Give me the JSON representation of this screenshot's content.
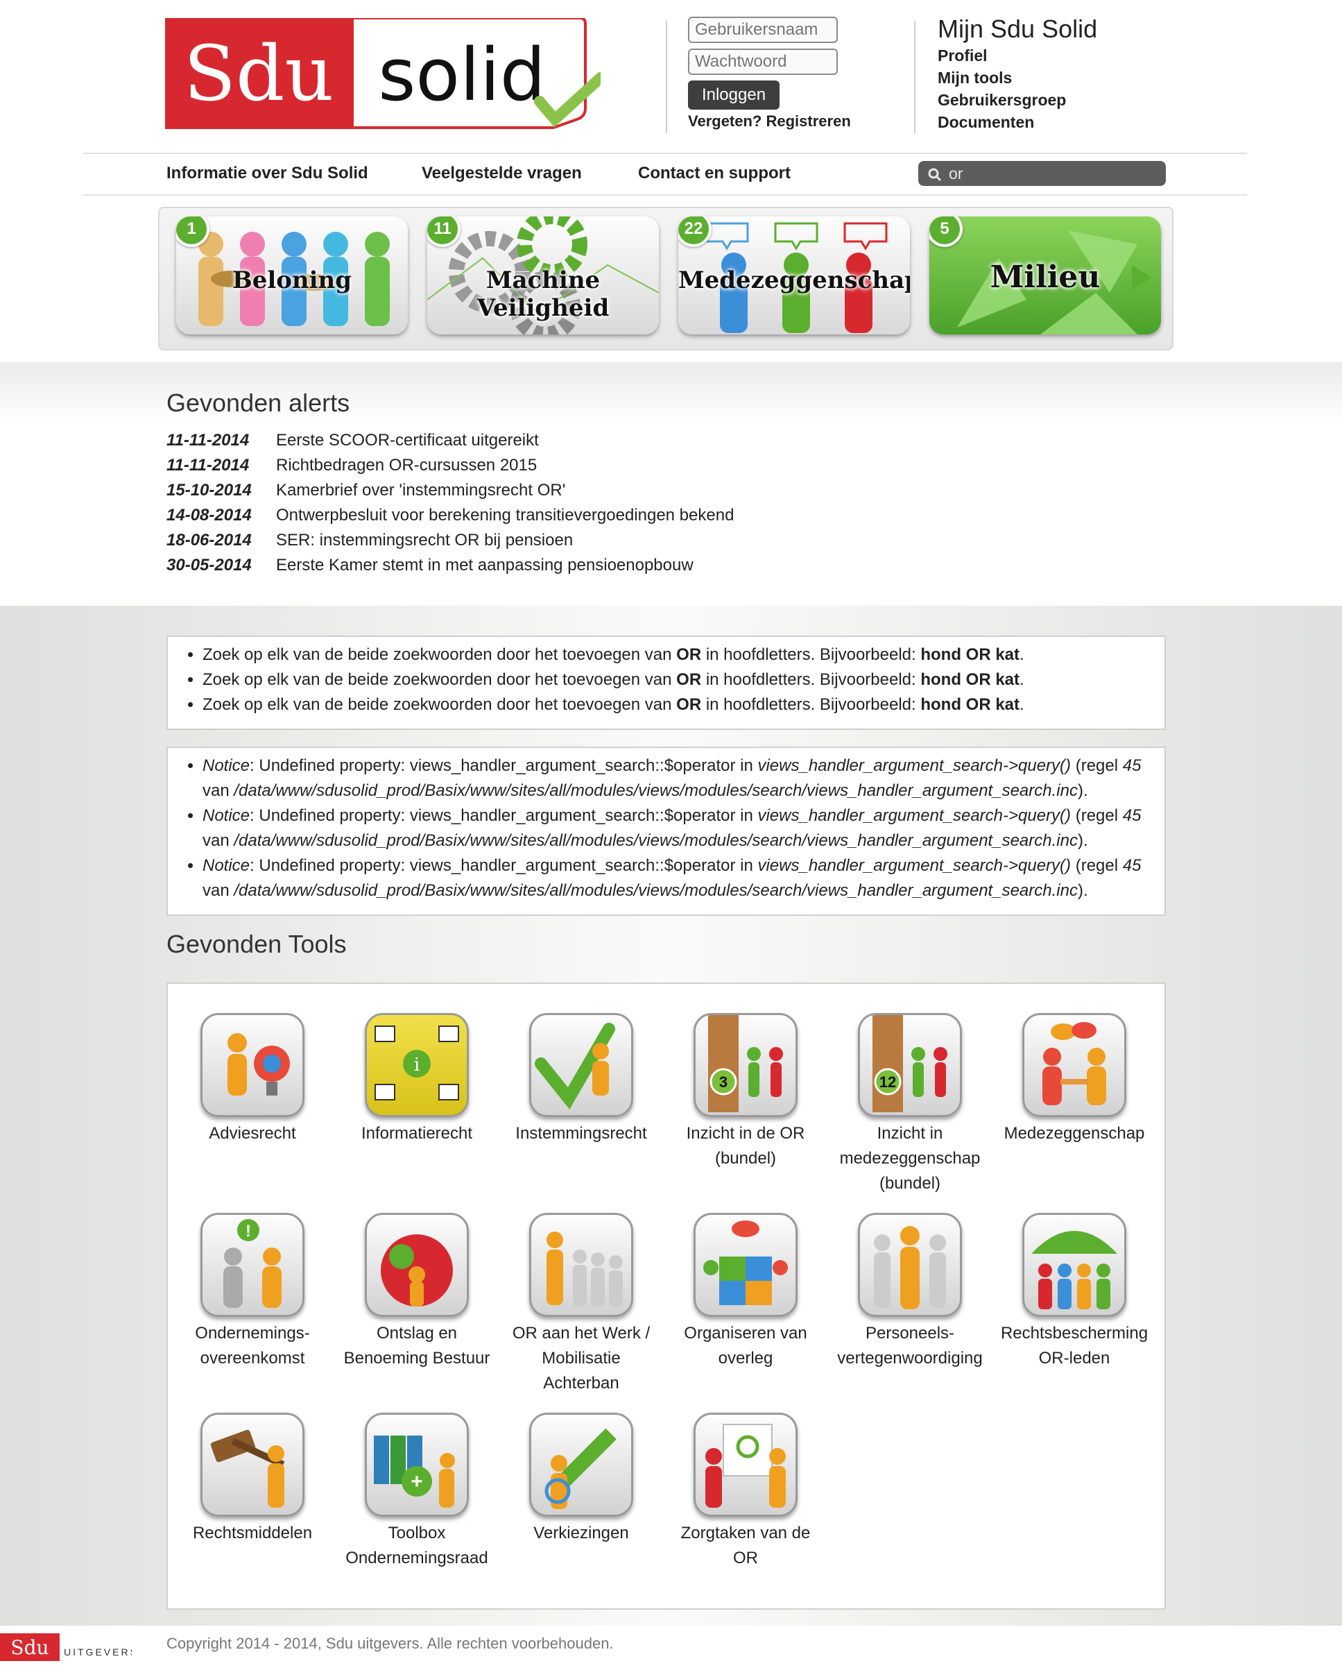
{
  "header": {
    "logo": {
      "left": "Sdu",
      "right": "solid"
    },
    "login": {
      "username_placeholder": "Gebruikersnaam",
      "password_placeholder": "Wachtwoord",
      "login_button": "Inloggen",
      "forgot": "Vergeten?",
      "register": "Registreren"
    },
    "mijn": {
      "title": "Mijn Sdu Solid",
      "links": [
        "Profiel",
        "Mijn tools",
        "Gebruikersgroep",
        "Documenten"
      ]
    }
  },
  "nav": {
    "items": [
      "Informatie over Sdu Solid",
      "Veelgestelde vragen",
      "Contact en support"
    ],
    "search_value": "or"
  },
  "carousel": {
    "cards": [
      {
        "badge": "1",
        "title": "Beloning"
      },
      {
        "badge": "11",
        "title": "Machine Veiligheid"
      },
      {
        "badge": "22",
        "title": "Medezeggenschap"
      },
      {
        "badge": "5",
        "title": "Milieu"
      }
    ]
  },
  "alerts": {
    "title": "Gevonden alerts",
    "items": [
      {
        "date": "11-11-2014",
        "text": "Eerste SCOOR-certificaat uitgereikt"
      },
      {
        "date": "11-11-2014",
        "text": "Richtbedragen OR-cursussen 2015"
      },
      {
        "date": "15-10-2014",
        "text": "Kamerbrief over 'instemmingsrecht OR'"
      },
      {
        "date": "14-08-2014",
        "text": "Ontwerpbesluit voor berekening transitievergoedingen bekend"
      },
      {
        "date": "18-06-2014",
        "text": "SER: instemmingsrecht OR bij pensioen"
      },
      {
        "date": "30-05-2014",
        "text": "Eerste Kamer stemt in met aanpassing pensioenopbouw"
      }
    ]
  },
  "search_tips": {
    "before": "Zoek op elk van de beide zoekwoorden door het toevoegen van ",
    "op": "OR",
    "middle": " in hoofdletters. Bijvoorbeeld: ",
    "example": "hond OR kat",
    "end": "."
  },
  "notices": {
    "label": "Notice",
    "text1": ": Undefined property: views_handler_argument_search::$operator in ",
    "func": "views_handler_argument_search->query()",
    "text2": " (regel ",
    "line": "45",
    "text3": " van ",
    "path": "/data/www/sdusolid_prod/Basix/www/sites/all/modules/views/modules/search/views_handler_argument_search.inc",
    "text4": ")."
  },
  "tools": {
    "title": "Gevonden Tools",
    "items": [
      {
        "label": "Adviesrecht",
        "icon": "advice-icon"
      },
      {
        "label": "Informatierecht",
        "icon": "information-icon"
      },
      {
        "label": "Instemmingsrecht",
        "icon": "checkmark-icon"
      },
      {
        "label": "Inzicht in de OR (bundel)",
        "icon": "bundle-3-icon",
        "badge": "3"
      },
      {
        "label": "Inzicht in medezeggenschap (bundel)",
        "icon": "bundle-12-icon",
        "badge": "12"
      },
      {
        "label": "Medezeggenschap",
        "icon": "handshake-talk-icon"
      },
      {
        "label": "Ondernemings-overeenkomst",
        "icon": "agreement-icon"
      },
      {
        "label": "Ontslag en Benoeming Bestuur",
        "icon": "puzzle-people-icon"
      },
      {
        "label": "OR aan het Werk / Mobilisatie Achterban",
        "icon": "leader-group-icon"
      },
      {
        "label": "Organiseren van overleg",
        "icon": "meeting-icon"
      },
      {
        "label": "Personeels-vertegenwoordiging",
        "icon": "representative-icon"
      },
      {
        "label": "Rechtsbescherming OR-leden",
        "icon": "umbrella-icon"
      },
      {
        "label": "Rechtsmiddelen",
        "icon": "gavel-icon"
      },
      {
        "label": "Toolbox Ondernemingsraad",
        "icon": "toolbox-icon"
      },
      {
        "label": "Verkiezingen",
        "icon": "vote-icon"
      },
      {
        "label": "Zorgtaken van de OR",
        "icon": "presentation-icon"
      }
    ]
  },
  "footer": {
    "copyright": "Copyright 2014 - 2014, Sdu uitgevers. Alle rechten voorbehouden.",
    "brand": "Sdu",
    "brand_sub": "UITGEVERS"
  },
  "colors": {
    "brand_red": "#d7282f",
    "accent_green": "#5cae2e",
    "dark_button": "#3e3e3e"
  }
}
